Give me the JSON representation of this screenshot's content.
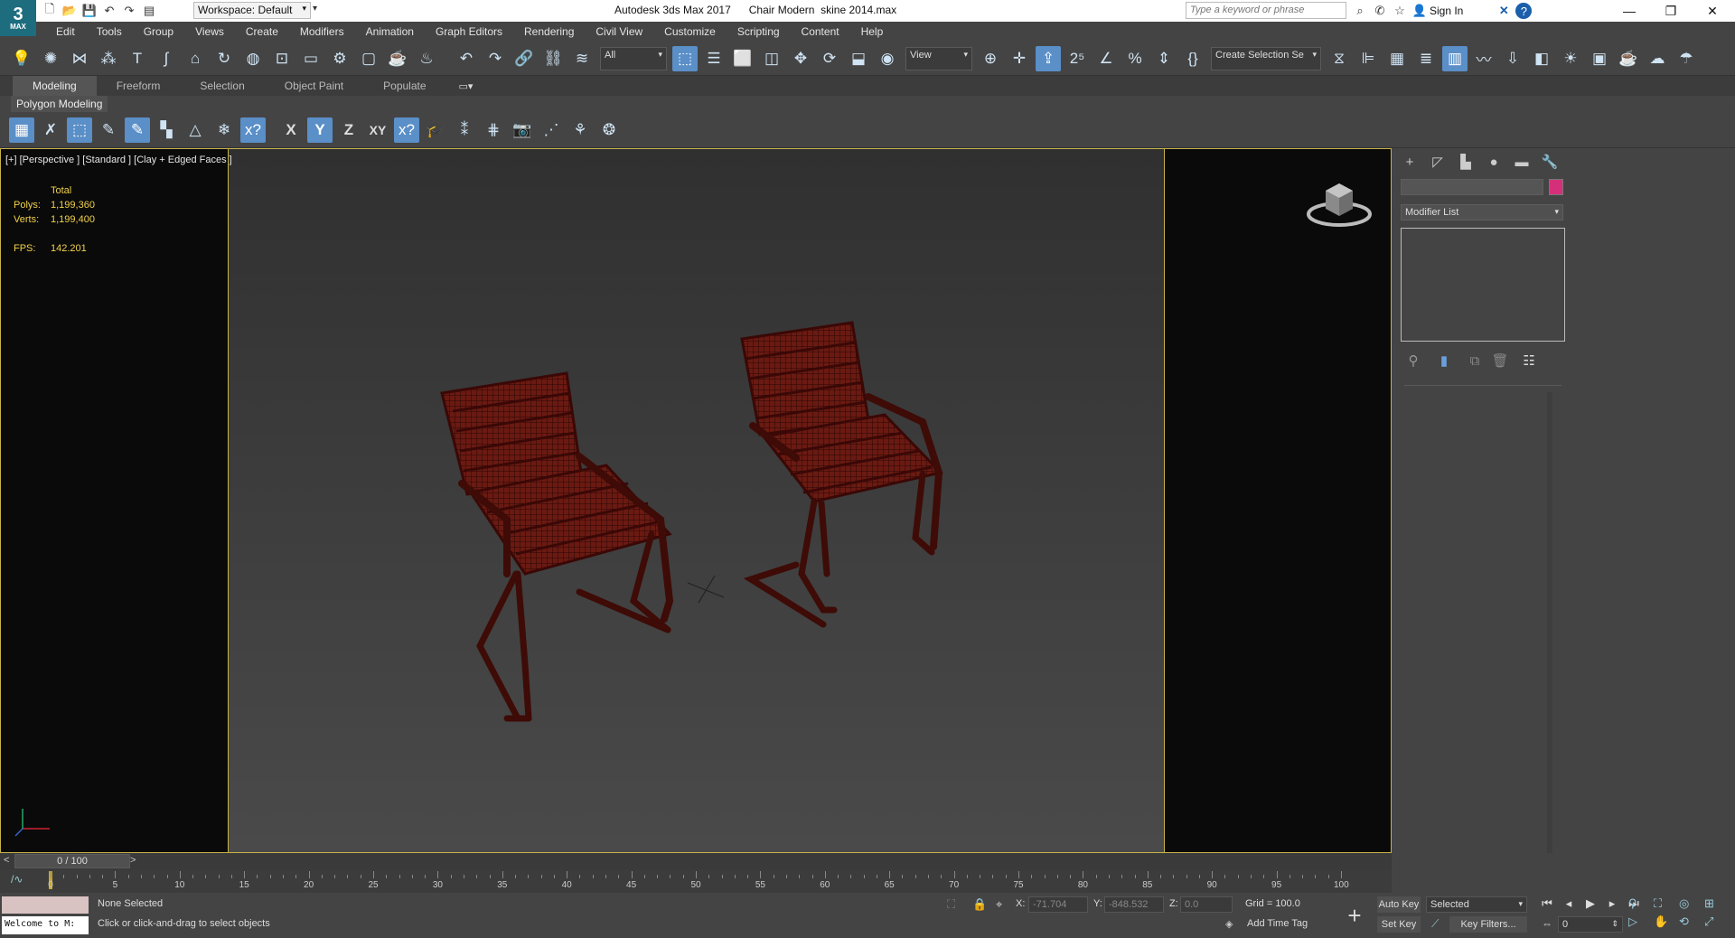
{
  "app": {
    "logo_text": "3",
    "logo_sub": "MAX",
    "title": "Autodesk 3ds Max 2017      Chair Modern  skine 2014.max",
    "workspace": "Workspace: Default",
    "search_placeholder": "Type a keyword or phrase",
    "sign_in": "Sign In"
  },
  "menu": [
    "Edit",
    "Tools",
    "Group",
    "Views",
    "Create",
    "Modifiers",
    "Animation",
    "Graph Editors",
    "Rendering",
    "Civil View",
    "Customize",
    "Scripting",
    "Content",
    "Help"
  ],
  "toolbar": {
    "selection_filter": "All",
    "ref_coord": "View",
    "named_selection": "Create Selection Se"
  },
  "ribbon": {
    "tabs": [
      "Modeling",
      "Freeform",
      "Selection",
      "Object Paint",
      "Populate"
    ],
    "active_tab": "Modeling",
    "panel_label": "Polygon Modeling",
    "axis_buttons": [
      "X",
      "Y",
      "Z",
      "XY"
    ]
  },
  "viewport": {
    "label": "[+] [Perspective ] [Standard ] [Clay + Edged Faces ]",
    "stats": {
      "total_label": "Total",
      "polys_label": "Polys:",
      "polys_value": "1,199,360",
      "verts_label": "Verts:",
      "verts_value": "1,199,400",
      "fps_label": "FPS:",
      "fps_value": "142.201"
    },
    "accent_color": "#c8b34a",
    "chair_color": "#7a1a10"
  },
  "command_panel": {
    "modifier_list": "Modifier List",
    "color_swatch": "#d4307a"
  },
  "timeline": {
    "frame_display": "0 / 100",
    "ticks": [
      "0",
      "5",
      "10",
      "15",
      "20",
      "25",
      "30",
      "35",
      "40",
      "45",
      "50",
      "55",
      "60",
      "65",
      "70",
      "75",
      "80",
      "85",
      "90",
      "95",
      "100"
    ]
  },
  "status": {
    "maxscript": "Welcome to M:",
    "selection": "None Selected",
    "prompt": "Click or click-and-drag to select objects",
    "x_label": "X:",
    "x_value": "-71.704",
    "y_label": "Y:",
    "y_value": "-848.532",
    "z_label": "Z:",
    "z_value": "0.0",
    "grid": "Grid = 100.0",
    "add_time_tag": "Add Time Tag",
    "auto_key": "Auto Key",
    "set_key": "Set Key",
    "key_mode": "Selected",
    "key_filters": "Key Filters...",
    "current_frame": "0"
  }
}
